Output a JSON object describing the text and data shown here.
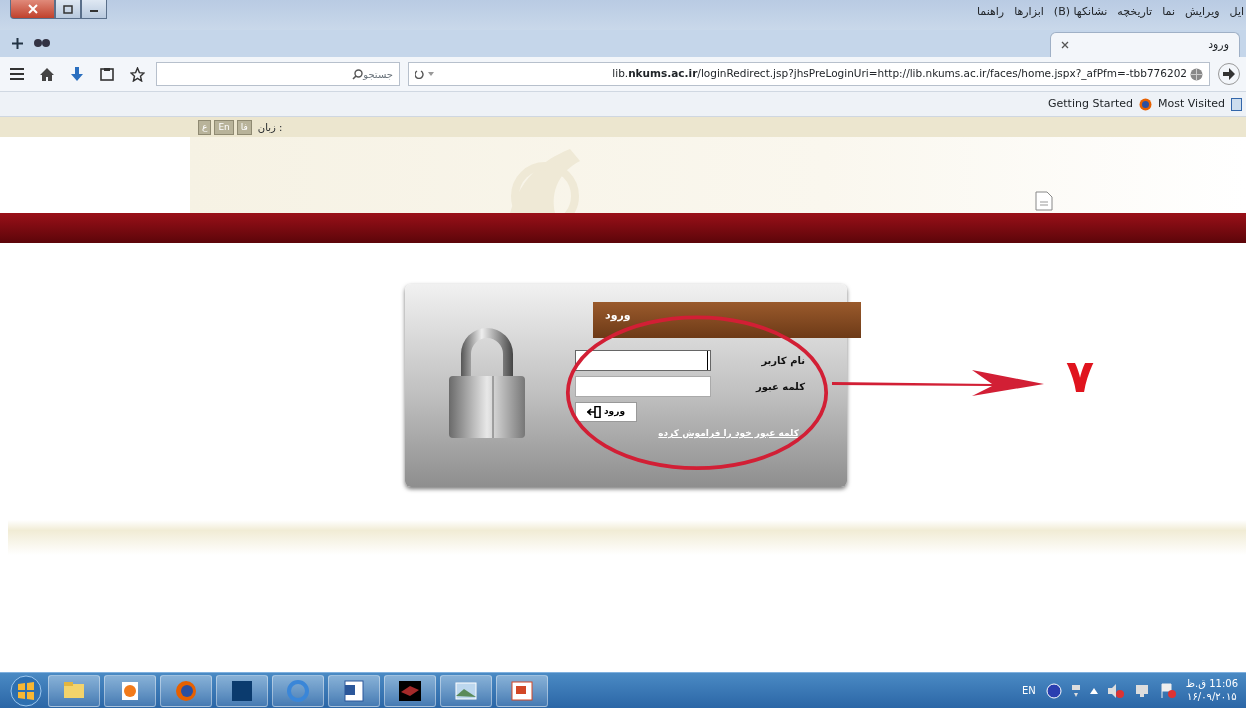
{
  "browser": {
    "menu": [
      "ایل",
      "ویرایش",
      "نما",
      "تاریخچه",
      "نشانکها (B)",
      "ابزارها",
      "راهنما"
    ],
    "tabs": [
      {
        "label": "ورود",
        "selected": true
      }
    ],
    "address": {
      "url": "lib.**nkums.ac.ir**/loginRedirect.jsp?jhsPreLoginUri=http://lib.nkums.ac.ir/faces/home.jspx?_afPfm=-tbb776202"
    },
    "search": {
      "placeholder": "جستجو"
    },
    "bookmarks": [
      "Most Visited",
      "Getting Started"
    ]
  },
  "page": {
    "language": {
      "label": "زبان :",
      "options": [
        "فا",
        "En",
        "ع"
      ]
    },
    "login": {
      "title": "ورود",
      "fields": [
        {
          "label": "نام کاربر",
          "focused": true
        },
        {
          "label": "کلمه عبور",
          "focused": false
        }
      ],
      "submit": "ورود",
      "forgot": "کلمه عبور خود را فراموش کرده"
    },
    "annotation": {
      "number": "۷"
    }
  },
  "taskbar": {
    "language": "EN",
    "time": "11:06 ق.ظ",
    "date": "۱۶/۰۹/۲۰۱۵"
  }
}
